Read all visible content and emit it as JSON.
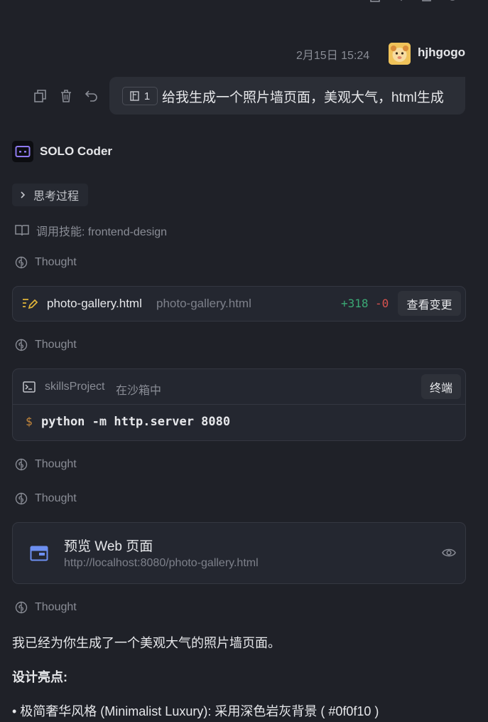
{
  "top_icons": [
    "copy-icon",
    "feedback-icon",
    "share-icon",
    "retry-icon"
  ],
  "user_message": {
    "timestamp": "2月15日 15:24",
    "username": "hjhgogo",
    "attachment_count": "1",
    "text": "给我生成一个照片墙页面，美观大气，html生成",
    "actions": [
      "copy-icon",
      "delete-icon",
      "undo-icon"
    ]
  },
  "agent": {
    "name": "SOLO Coder",
    "thinking_label": "思考过程",
    "skill_label": "调用技能: frontend-design",
    "thought_label": "Thought"
  },
  "file_change": {
    "name": "photo-gallery.html",
    "path": "photo-gallery.html",
    "added": "+318",
    "removed": "-0",
    "view_label": "查看变更"
  },
  "terminal": {
    "project": "skillsProject",
    "sandbox": "在沙箱中",
    "button": "终端",
    "prompt": "$",
    "command": "python -m http.server 8080"
  },
  "preview": {
    "title": "预览 Web 页面",
    "url": "http://localhost:8080/photo-gallery.html"
  },
  "response": {
    "intro": "我已经为你生成了一个美观大气的照片墙页面。",
    "highlights_title": "设计亮点:",
    "first_bullet": "• 极简奢华风格 (Minimalist Luxury): 采用深色岩灰背景 ( #0f0f10 )"
  },
  "colors": {
    "background": "#1f2128",
    "card": "#242730",
    "added": "#3ba975",
    "removed": "#d9534f",
    "accent": "#6d8ff0"
  }
}
